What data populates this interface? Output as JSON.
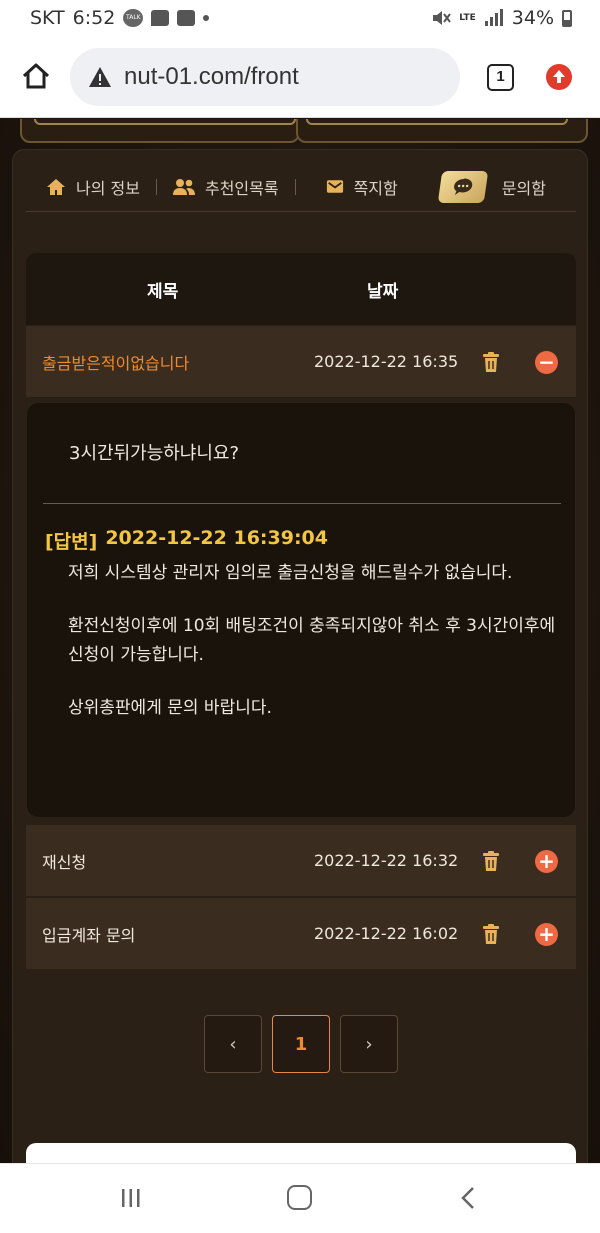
{
  "status_bar": {
    "carrier": "SKT",
    "time": "6:52",
    "talk_badge": "TALK",
    "network": "LTE",
    "battery": "34%",
    "icons": [
      "kakaotalk-icon",
      "message-icon",
      "gallery-icon",
      "mute-icon",
      "signal-icon",
      "battery-icon"
    ]
  },
  "browser": {
    "url": "nut-01.com/front",
    "tab_count": "1",
    "icons": [
      "home-icon",
      "warning-icon",
      "update-icon"
    ]
  },
  "tabs": [
    {
      "label": "나의 정보",
      "icon": "home-icon"
    },
    {
      "label": "추천인목록",
      "icon": "users-icon"
    },
    {
      "label": "쪽지함",
      "icon": "envelope-icon"
    },
    {
      "label": "문의함",
      "icon": "chat-icon",
      "active": true
    }
  ],
  "table": {
    "headers": {
      "title": "제목",
      "date": "날짜"
    },
    "rows": [
      {
        "title": "출금받은적이없습니다",
        "date": "2022-12-22 16:35",
        "expanded": true
      },
      {
        "title": "재신청",
        "date": "2022-12-22 16:32",
        "expanded": false
      },
      {
        "title": "입금계좌 문의",
        "date": "2022-12-22 16:02",
        "expanded": false
      }
    ]
  },
  "detail": {
    "question": "3시간뒤가능하냐니요?",
    "answer_tag": "[답변]",
    "answer_date": "2022-12-22 16:39:04",
    "answer_paragraphs": [
      "저희 시스템상 관리자 임의로 출금신청을 해드릴수가 없습니다.",
      "환전신청이후에 10회 배팅조건이 충족되지않아 취소 후 3시간이후에 신청이 가능합니다.",
      "상위총판에게 문의 바랍니다."
    ]
  },
  "pagination": {
    "prev": "‹",
    "current": "1",
    "next": "›"
  },
  "colors": {
    "accent_orange": "#f08a2e",
    "answer_gold": "#f3c642",
    "toggle_red": "#ee6a45"
  }
}
